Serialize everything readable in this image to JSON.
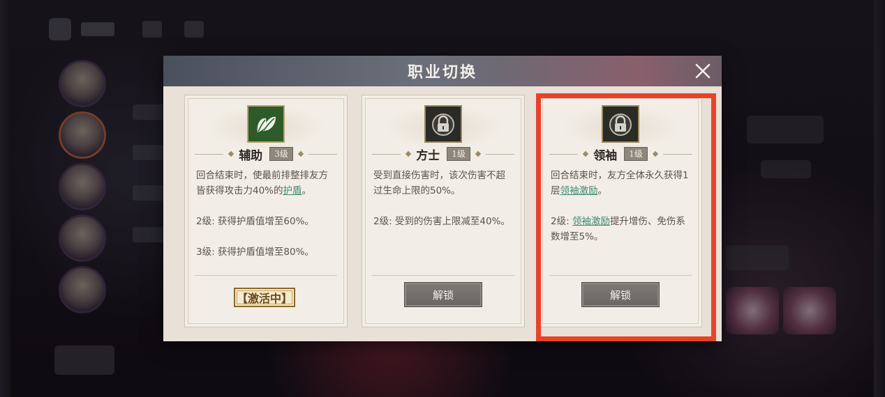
{
  "dialog": {
    "title": "职业切换"
  },
  "cards": [
    {
      "name": "辅助",
      "level": "3级",
      "icon": "leaf-icon",
      "status": "unlocked",
      "desc": [
        {
          "pre": "回合结束时，使最前排整排友方皆获得攻击力40%的",
          "hl": "护盾",
          "post": "。"
        },
        {
          "pre": "2级: 获得护盾值增至60%。",
          "hl": "",
          "post": ""
        },
        {
          "pre": "3级: 获得护盾值增至80%。",
          "hl": "",
          "post": ""
        }
      ],
      "active_label": "【激活中】"
    },
    {
      "name": "方士",
      "level": "1级",
      "icon": "lock-icon",
      "status": "locked",
      "desc": [
        {
          "pre": "受到直接伤害时，该次伤害不超过生命上限的50%。",
          "hl": "",
          "post": ""
        },
        {
          "pre": "2级: 受到的伤害上限减至40%。",
          "hl": "",
          "post": ""
        }
      ],
      "button_label": "解锁"
    },
    {
      "name": "领袖",
      "level": "1级",
      "icon": "lock-icon",
      "status": "locked",
      "desc": [
        {
          "pre": "回合结束时，友方全体永久获得1层",
          "hl": "领袖激励",
          "post": "。"
        },
        {
          "pre": "2级: ",
          "hl": "领袖激励",
          "post": "提升增伤、免伤系数增至5%。"
        }
      ],
      "button_label": "解锁"
    }
  ],
  "colors": {
    "highlight_box": "#e8432a",
    "keyword": "#3f8a72",
    "header": "#6b6f7a"
  }
}
